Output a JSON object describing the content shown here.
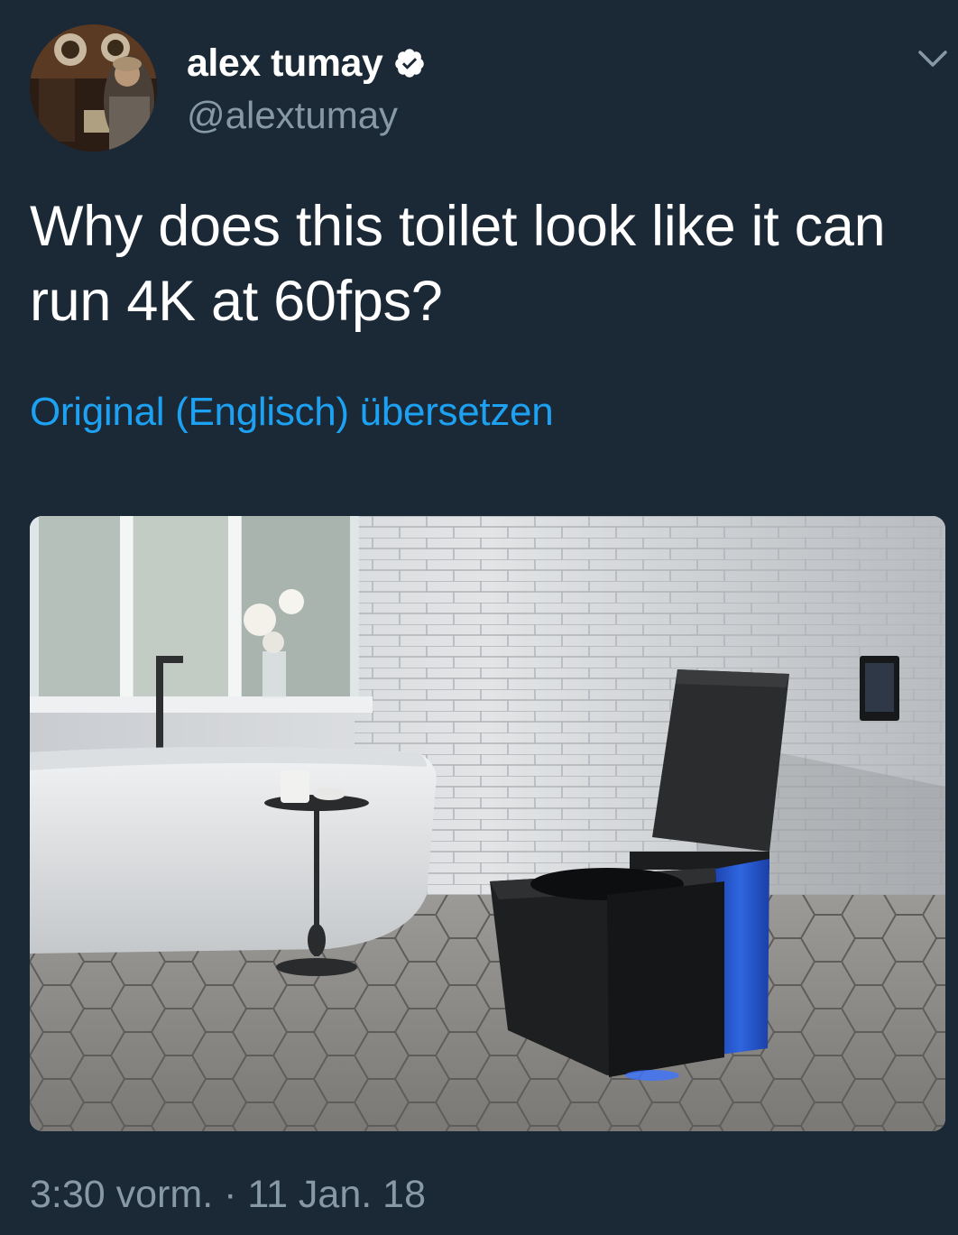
{
  "author": {
    "display_name": "alex tumay",
    "handle": "@alextumay",
    "verified": true,
    "avatar_icon": "profile-photo"
  },
  "menu_icon": "chevron-down-icon",
  "tweet": {
    "text": "Why does this toilet look like it can run 4K at 60fps?",
    "translate_label": "Original (Englisch) übersetzen",
    "media": "photo of a black smart toilet with blue side light in a white brick bathroom",
    "timestamp": "3:30 vorm. · 11 Jan. 18"
  },
  "colors": {
    "background": "#1b2836",
    "link": "#1da1f2",
    "secondary_text": "#8899a6",
    "verified_badge": "#ffffff"
  }
}
